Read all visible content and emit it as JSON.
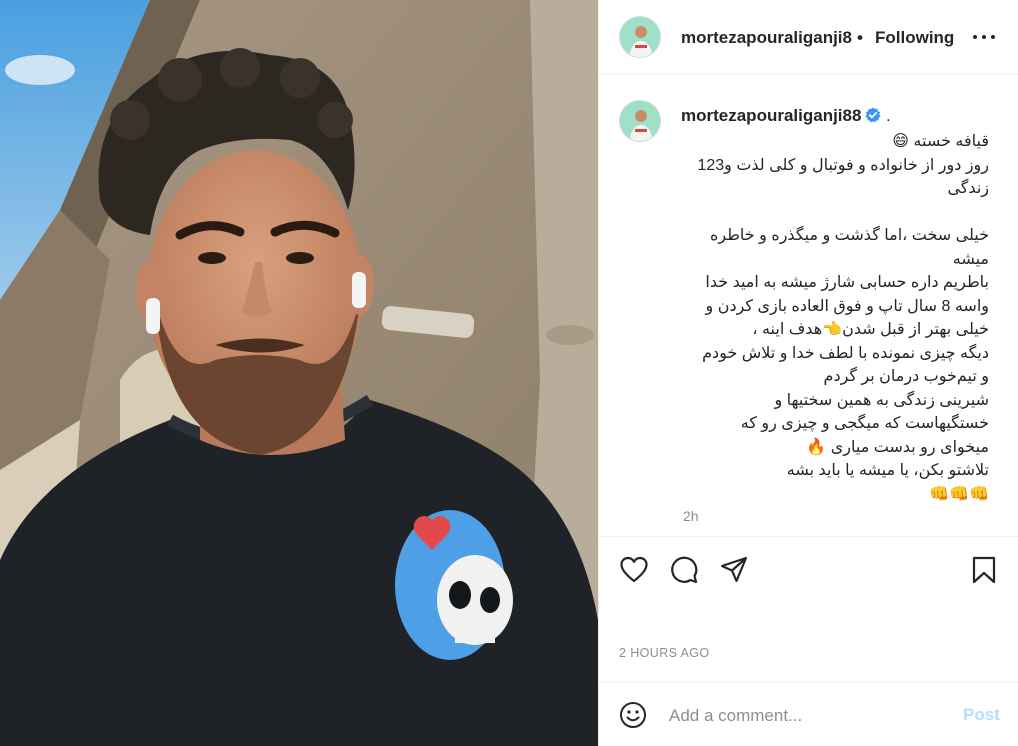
{
  "post": {
    "photo_alt": "selfie",
    "author": {
      "username": "mortezapouraliganji88",
      "header_username": "mortezapouraliganji8",
      "verified": true
    },
    "header": {
      "separator": "•",
      "follow_state": "Following",
      "more_icon": "more-horizontal-icon"
    },
    "caption": {
      "trailing": ".",
      "lines": [
        "قیافه خسته 😄",
        "روز دور از خانواده و فوتبال و کلی لذت و123",
        "زندگی",
        "",
        "خیلی سخت ،اما گذشت و میگذره و خاطره",
        "میشه",
        "باطریم داره حسابی شارژ میشه به امید خدا",
        "واسه 8 سال تاپ و فوق العاده بازی کردن و",
        "خیلی بهتر از قبل شدن👈هدف اینه ،",
        "دیگه چیزی نمونده با لطف خدا و تلاش خودم",
        "و تیم‌خوب درمان بر گردم",
        "شیرینی زندگی به همین سختیها و",
        "خستگیهاست که میگجی و چیزی رو که",
        "میخوای رو بدست میاری 🔥",
        "تلاشتو بکن، یا میشه یا باید بشه",
        "👊👊👊"
      ],
      "time": "2h"
    },
    "actions": {
      "like_icon": "heart-icon",
      "comment_icon": "comment-icon",
      "share_icon": "send-icon",
      "save_icon": "bookmark-icon"
    },
    "age": "2 HOURS AGO",
    "comment_box": {
      "emoji_icon": "smiley-icon",
      "placeholder": "Add a comment...",
      "post_label": "Post"
    }
  }
}
